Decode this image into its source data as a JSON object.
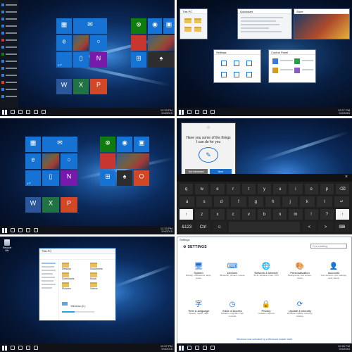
{
  "colors": {
    "accent": "#1673d3",
    "taskbar": "#101218",
    "keyboard": "#1f1f1f"
  },
  "panel1": {
    "clock": {
      "time": "12:33 PM",
      "date": "9/4/2015"
    },
    "tiles": {
      "weather": "17°",
      "photo": "",
      "mail": "Mail",
      "edge": "e"
    }
  },
  "panel2": {
    "clock": {
      "time": "12:27 PM",
      "date": "9/4/2015"
    },
    "windows": {
      "explorer": "This PC",
      "explorer2": "Quickstart",
      "store": "Store",
      "settings": "Settings",
      "control": "Control Panel"
    }
  },
  "panel3": {
    "clock": {
      "time": "12:33 PM",
      "date": "9/4/2015"
    }
  },
  "panel4": {
    "cortana": {
      "question": "Have you some of the things I can do for you",
      "btn_left": "Not interested",
      "btn_right": "Next"
    },
    "keyboard": {
      "row1": [
        "q",
        "w",
        "e",
        "r",
        "t",
        "y",
        "u",
        "i",
        "o",
        "p",
        "⌫"
      ],
      "row2": [
        "a",
        "s",
        "d",
        "f",
        "g",
        "h",
        "j",
        "k",
        "l",
        "↵"
      ],
      "row3": [
        "↑",
        "z",
        "x",
        "c",
        "v",
        "b",
        "n",
        "m",
        "!",
        "?",
        "↑"
      ],
      "row4": [
        "&123",
        "Ctrl",
        "☺",
        "",
        "<",
        ">",
        "⌨"
      ]
    }
  },
  "panel5": {
    "recycle_bin": "Recycle Bin",
    "explorer_title": "This PC",
    "folders": [
      "Desktop",
      "Documents",
      "Downloads",
      "Music",
      "Pictures",
      "Videos"
    ],
    "drive_label": "Windows (C:)",
    "clock": {
      "time": "12:37 PM",
      "date": "9/4/2015"
    }
  },
  "panel6": {
    "window_title": "Settings",
    "header": "SETTINGS",
    "search_placeholder": "Find a setting",
    "categories": [
      {
        "icon": "🖥",
        "name": "System",
        "desc": "Display, notifications, apps, power"
      },
      {
        "icon": "⌨",
        "name": "Devices",
        "desc": "Bluetooth, printers, mouse"
      },
      {
        "icon": "🌐",
        "name": "Network & Internet",
        "desc": "Wi-Fi, airplane mode, VPN"
      },
      {
        "icon": "🎨",
        "name": "Personalization",
        "desc": "Background, lock screen, colors"
      },
      {
        "icon": "👤",
        "name": "Accounts",
        "desc": "Your account, sync settings, work, family"
      },
      {
        "icon": "字",
        "name": "Time & language",
        "desc": "Speech, region, date"
      },
      {
        "icon": "◷",
        "name": "Ease of Access",
        "desc": "Narrator, magnifier, high contrast"
      },
      {
        "icon": "🔒",
        "name": "Privacy",
        "desc": "Location, camera"
      },
      {
        "icon": "⟳",
        "name": "Update & security",
        "desc": "Windows Update, recovery, backup"
      }
    ],
    "link": "Windows was activated by a Windows Insider build",
    "clock": {
      "time": "12:38 PM",
      "date": "9/4/2015"
    }
  }
}
